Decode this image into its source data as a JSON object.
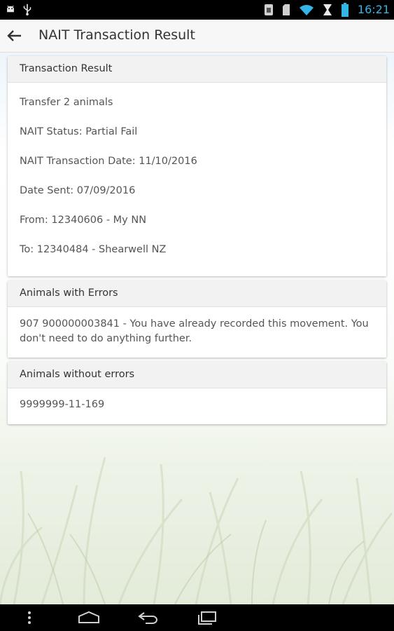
{
  "status_bar": {
    "time": "16:21",
    "icons": [
      "android-icon",
      "usb-icon",
      "sim-icon",
      "sd-card-icon",
      "wifi-icon",
      "hourglass-icon",
      "battery-icon"
    ]
  },
  "app_bar": {
    "title": "NAIT Transaction Result",
    "back_icon": "arrow-left-icon"
  },
  "transaction_result": {
    "header": "Transaction Result",
    "lines": [
      "Transfer 2 animals",
      "NAIT Status: Partial Fail",
      "NAIT Transaction Date: 11/10/2016",
      "Date Sent: 07/09/2016",
      "From: 12340606 - My NN",
      "To: 12340484 - Shearwell NZ"
    ]
  },
  "animals_with_errors": {
    "header": "Animals with Errors",
    "items": [
      "907 900000003841 - You have already recorded this movement. You don't need to do anything further."
    ]
  },
  "animals_without_errors": {
    "header": "Animals without errors",
    "items": [
      "9999999-11-169"
    ]
  },
  "nav_bar": {
    "icons": [
      "menu-dots-icon",
      "home-icon",
      "back-icon",
      "recents-icon"
    ]
  },
  "colors": {
    "status_accent": "#33b5e5",
    "card_header_bg": "#f2f2f2",
    "app_bar_bg": "#f7f7f7"
  }
}
